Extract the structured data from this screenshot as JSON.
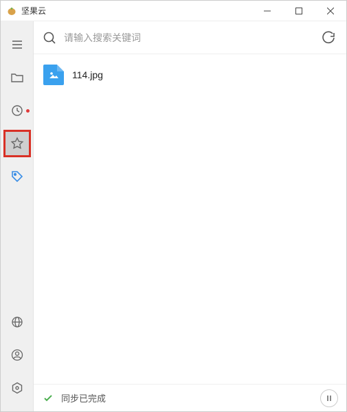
{
  "app": {
    "title": "坚果云"
  },
  "search": {
    "placeholder": "请输入搜索关键词",
    "value": ""
  },
  "sidebar": {
    "items": [
      {
        "icon": "menu-icon"
      },
      {
        "icon": "folder-icon"
      },
      {
        "icon": "clock-icon",
        "has_dot": true
      },
      {
        "icon": "star-icon",
        "selected": true
      },
      {
        "icon": "tag-icon"
      }
    ],
    "bottom_items": [
      {
        "icon": "globe-icon"
      },
      {
        "icon": "user-icon"
      },
      {
        "icon": "settings-icon"
      }
    ]
  },
  "files": [
    {
      "name": "114.jpg",
      "type": "image"
    }
  ],
  "status": {
    "text": "同步已完成"
  }
}
